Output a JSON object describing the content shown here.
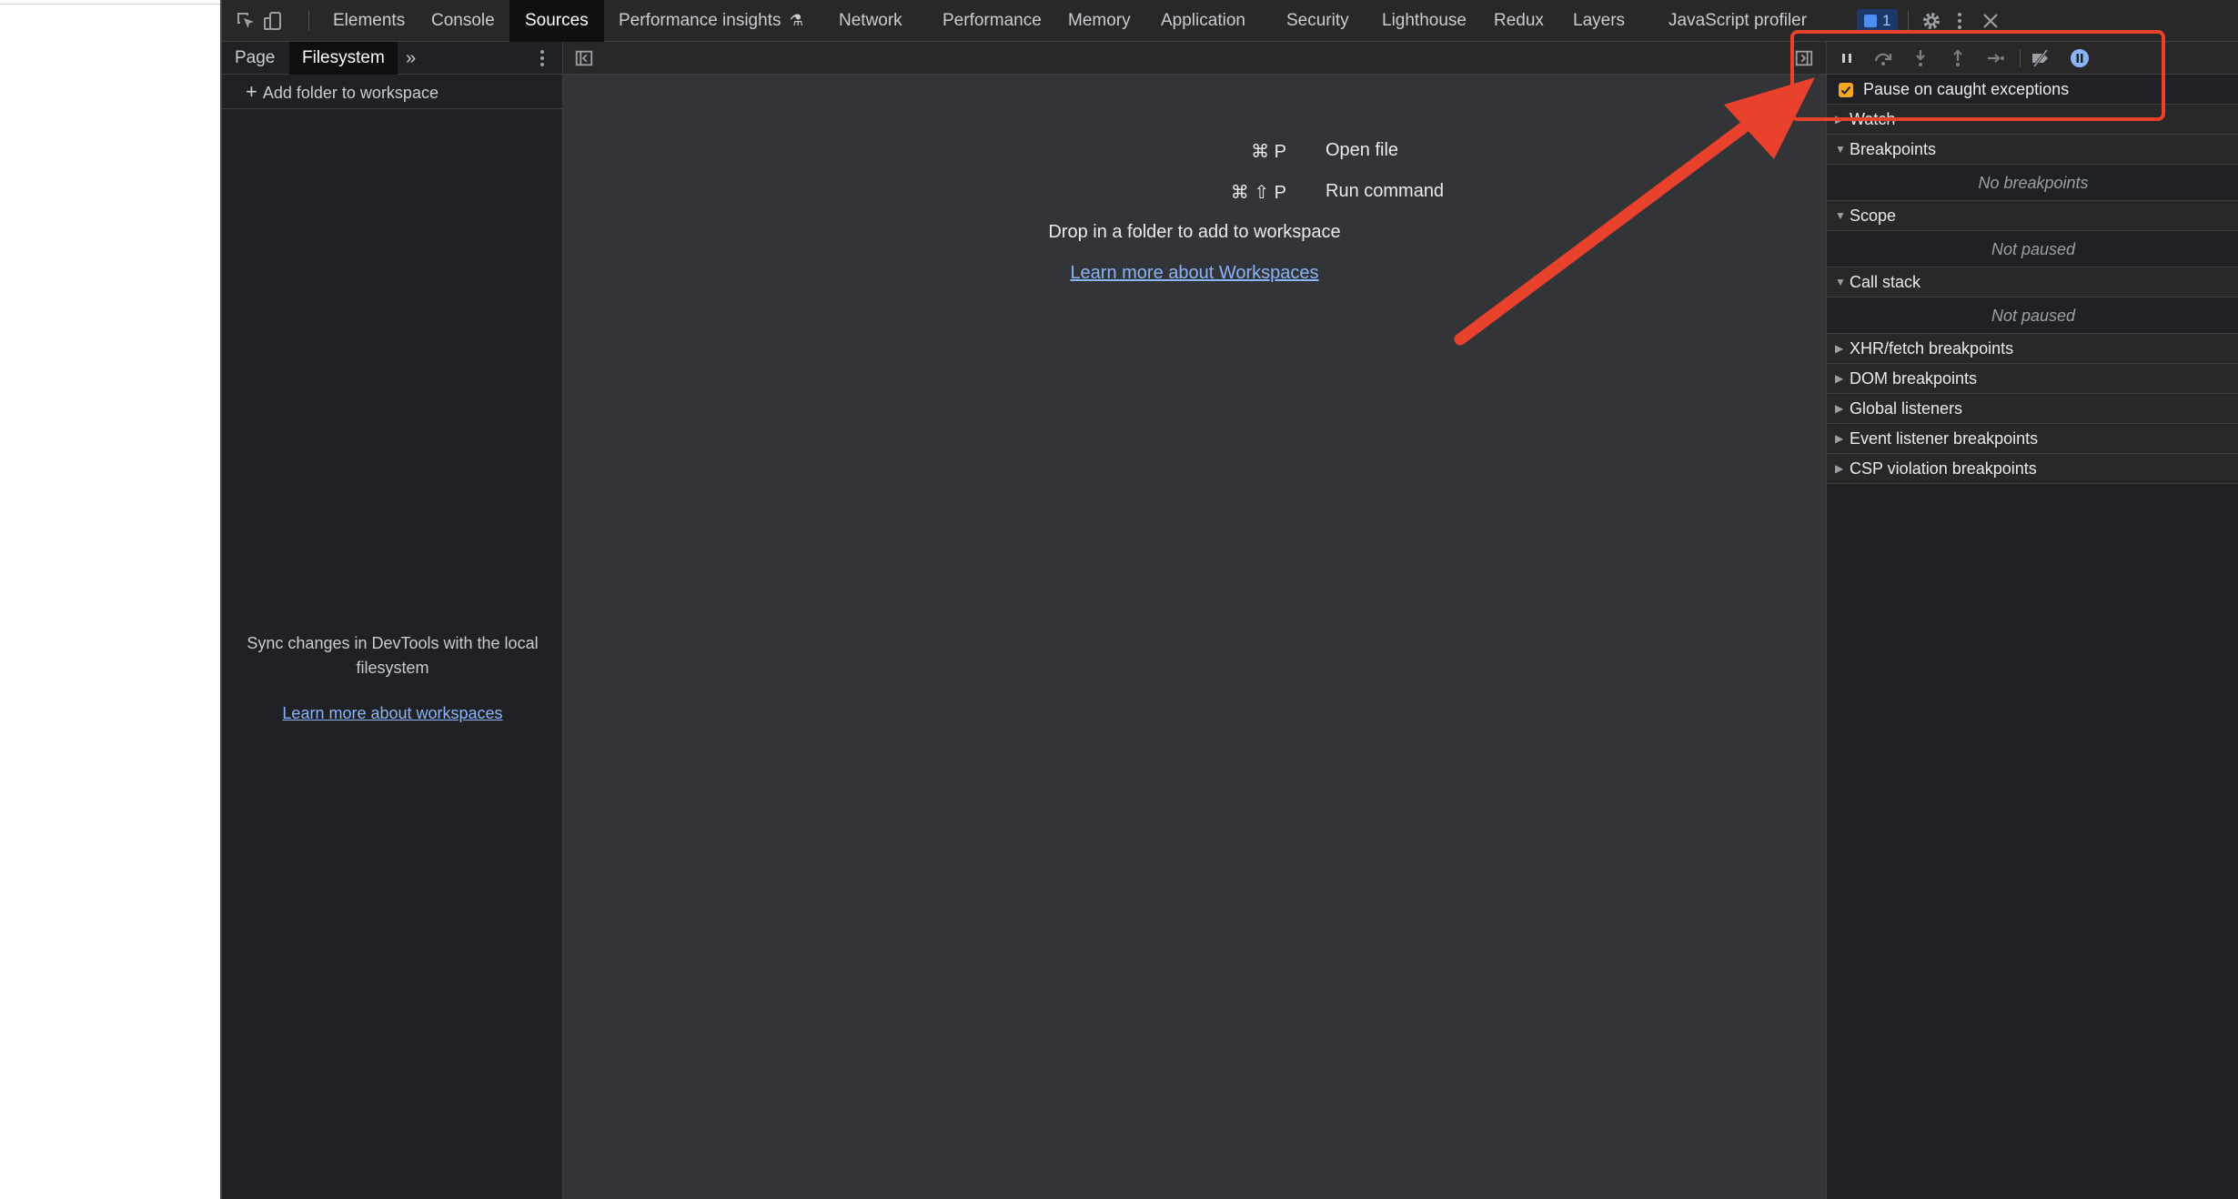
{
  "tabs": [
    "Elements",
    "Console",
    "Sources",
    "Performance insights",
    "Network",
    "Performance",
    "Memory",
    "Application",
    "Security",
    "Lighthouse",
    "Redux",
    "Layers",
    "JavaScript profiler"
  ],
  "active_tab": "Sources",
  "issues_count": "1",
  "navigator": {
    "tabs": [
      "Page",
      "Filesystem"
    ],
    "active": "Filesystem",
    "add_folder": "Add folder to workspace",
    "sync_text": "Sync changes in DevTools with the local filesystem",
    "learn_link": "Learn more about workspaces"
  },
  "editor": {
    "shortcuts": [
      {
        "key": "⌘ P",
        "label": "Open file"
      },
      {
        "key": "⌘ ⇧ P",
        "label": "Run command"
      }
    ],
    "drop_text": "Drop in a folder to add to workspace",
    "learn_link": "Learn more about Workspaces"
  },
  "debugger": {
    "pause_caught": "Pause on caught exceptions",
    "watch": "Watch",
    "breakpoints": "Breakpoints",
    "no_breakpoints": "No breakpoints",
    "scope": "Scope",
    "scope_status": "Not paused",
    "call_stack": "Call stack",
    "call_stack_status": "Not paused",
    "collapsed_panes": [
      "XHR/fetch breakpoints",
      "DOM breakpoints",
      "Global listeners",
      "Event listener breakpoints",
      "CSP violation breakpoints"
    ]
  },
  "colors": {
    "accent_link": "#8ab4f8",
    "checkbox": "#f5a623",
    "annotation": "#e8412c"
  }
}
